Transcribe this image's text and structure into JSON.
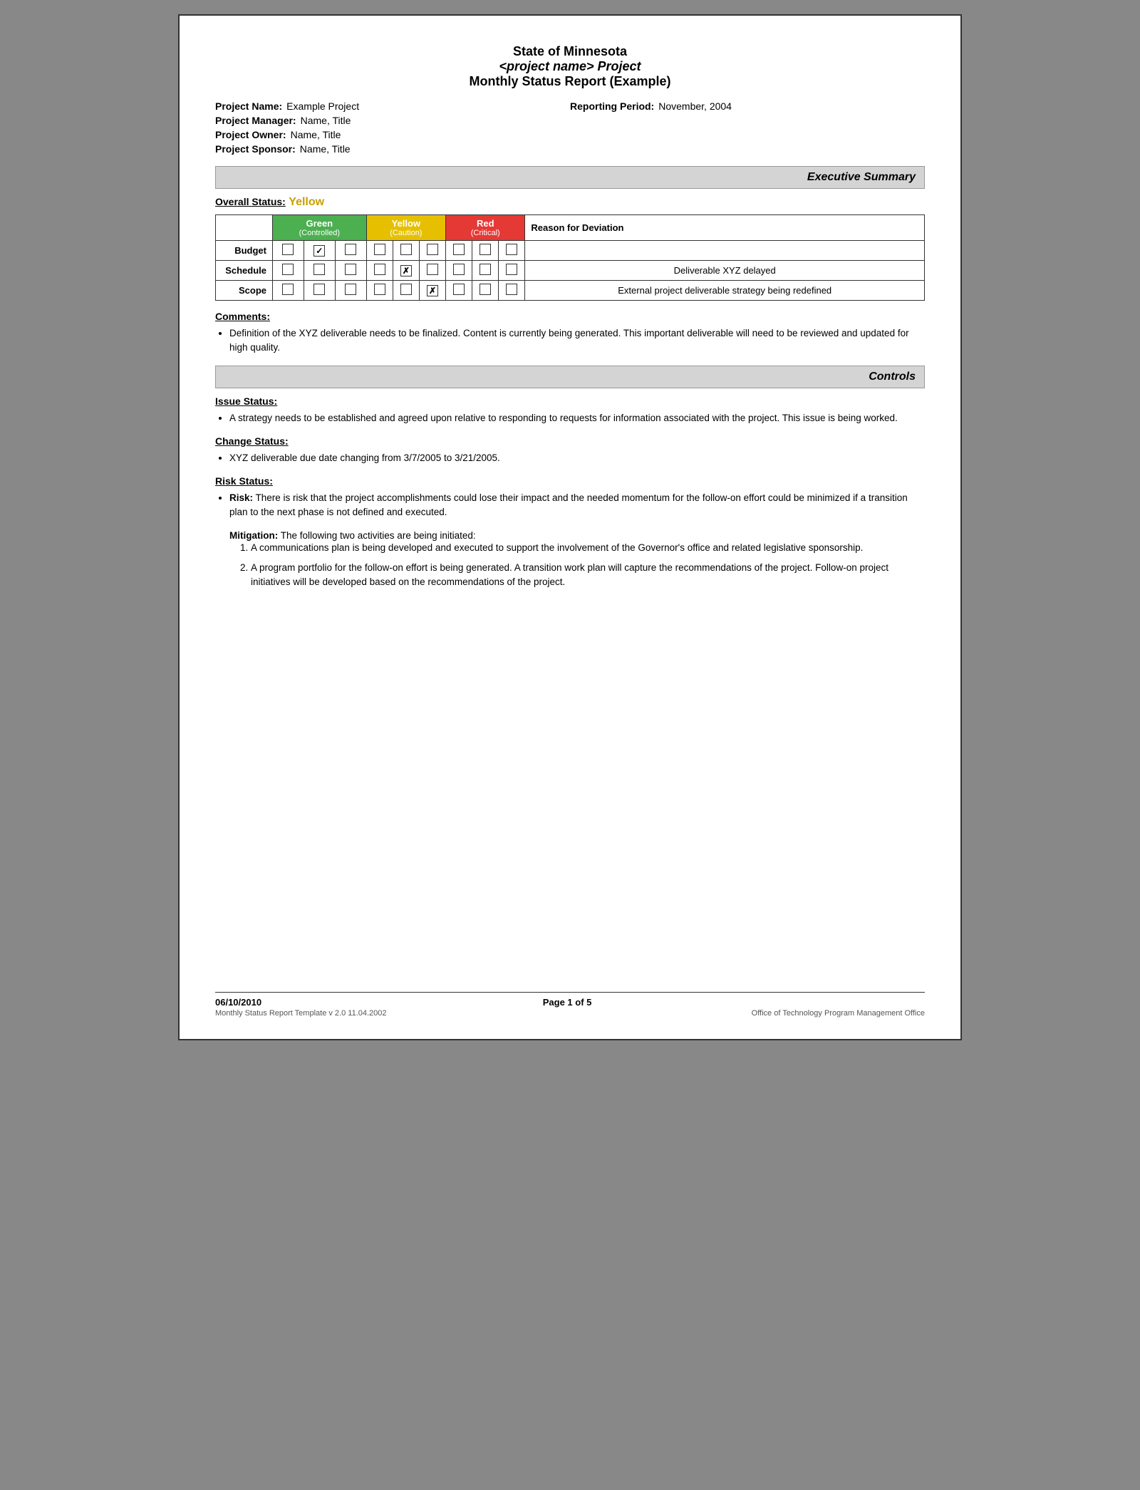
{
  "header": {
    "line1": "State of Minnesota",
    "line2": "<project name> Project",
    "line3": "Monthly Status Report (Example)"
  },
  "meta": {
    "project_name_label": "Project Name:",
    "project_name_value": "Example Project",
    "reporting_period_label": "Reporting Period:",
    "reporting_period_value": "November, 2004",
    "project_manager_label": "Project Manager:",
    "project_manager_value": "Name, Title",
    "project_owner_label": "Project Owner:",
    "project_owner_value": "Name, Title",
    "project_sponsor_label": "Project Sponsor:",
    "project_sponsor_value": "Name, Title"
  },
  "executive_summary": {
    "section_title": "Executive Summary",
    "overall_status_label": "Overall Status:",
    "overall_status_value": "Yellow",
    "table_headers": {
      "green": "Green",
      "green_sub": "(Controlled)",
      "yellow": "Yellow",
      "yellow_sub": "(Caution)",
      "red": "Red",
      "red_sub": "(Critical)",
      "reason": "Reason for Deviation"
    },
    "rows": [
      {
        "label": "Budget",
        "green": [
          false,
          true,
          false
        ],
        "yellow": [
          false,
          false,
          false
        ],
        "red": [
          false,
          false,
          false
        ],
        "reason": ""
      },
      {
        "label": "Schedule",
        "green": [
          false,
          false,
          false
        ],
        "yellow": [
          false,
          true,
          false
        ],
        "red": [
          false,
          false,
          false
        ],
        "reason": "Deliverable XYZ delayed"
      },
      {
        "label": "Scope",
        "green": [
          false,
          false,
          false
        ],
        "yellow": [
          false,
          false,
          true
        ],
        "red": [
          false,
          false,
          false
        ],
        "reason": "External project deliverable strategy being redefined"
      }
    ],
    "comments_label": "Comments:",
    "comments": [
      "Definition of the XYZ deliverable needs to be finalized.  Content is currently being generated.  This important deliverable will need to be reviewed and updated for high quality."
    ]
  },
  "controls": {
    "section_title": "Controls",
    "issue_status_label": "Issue Status:",
    "issue_status_items": [
      "A strategy needs to be established and agreed upon relative to responding to requests for information associated with the project.  This issue is being worked."
    ],
    "change_status_label": "Change Status:",
    "change_status_items": [
      "XYZ deliverable due date changing from 3/7/2005 to 3/21/2005."
    ],
    "risk_status_label": "Risk Status:",
    "risk_bold": "Risk:",
    "risk_text": " There is risk that the project accomplishments could lose their impact and the needed momentum for the follow-on effort could be minimized if a transition plan to the next phase is not defined and executed.",
    "mitigation_bold": "Mitigation:",
    "mitigation_intro": " The following two activities are being initiated:",
    "mitigation_items": [
      "A communications plan is being developed and executed to support the involvement of the Governor's office and related legislative sponsorship.",
      "A program portfolio for the follow-on effort is being generated. A transition work plan will capture the recommendations of the project. Follow-on project initiatives will be developed based on the recommendations of the project."
    ]
  },
  "footer": {
    "date": "06/10/2010",
    "page": "Page 1 of 5",
    "template_note": "Monthly Status Report Template  v 2.0  11.04.2002",
    "office": "Office of Technology Program Management Office"
  }
}
